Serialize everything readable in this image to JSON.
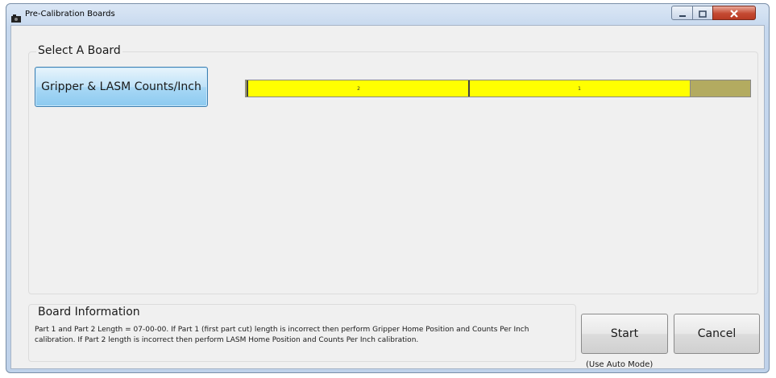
{
  "window": {
    "title": "Pre-Calibration Boards"
  },
  "select_group": {
    "label": "Select A Board",
    "board_button_label": "Gripper & LASM Counts/Inch",
    "board_bar": {
      "segments": [
        {
          "label": "2",
          "fraction": 0.44
        },
        {
          "label": "1",
          "fraction": 0.44
        }
      ],
      "remaining_fraction": 0.12,
      "segment_color": "#ffff00",
      "remaining_color": "#b3ab60"
    }
  },
  "info_group": {
    "label": "Board Information",
    "text": "Part 1 and Part 2 Length = 07-00-00.  If Part 1 (first part cut) length is incorrect then perform Gripper Home Position and Counts Per Inch calibration.  If Part 2 length is incorrect then perform LASM Home Position and Counts Per Inch calibration."
  },
  "actions": {
    "start_label": "Start",
    "cancel_label": "Cancel",
    "auto_mode_note": "(Use Auto Mode)"
  },
  "icons": {
    "app": "camera-icon",
    "minimize": "minimize-icon",
    "maximize": "maximize-icon",
    "close": "close-icon"
  }
}
